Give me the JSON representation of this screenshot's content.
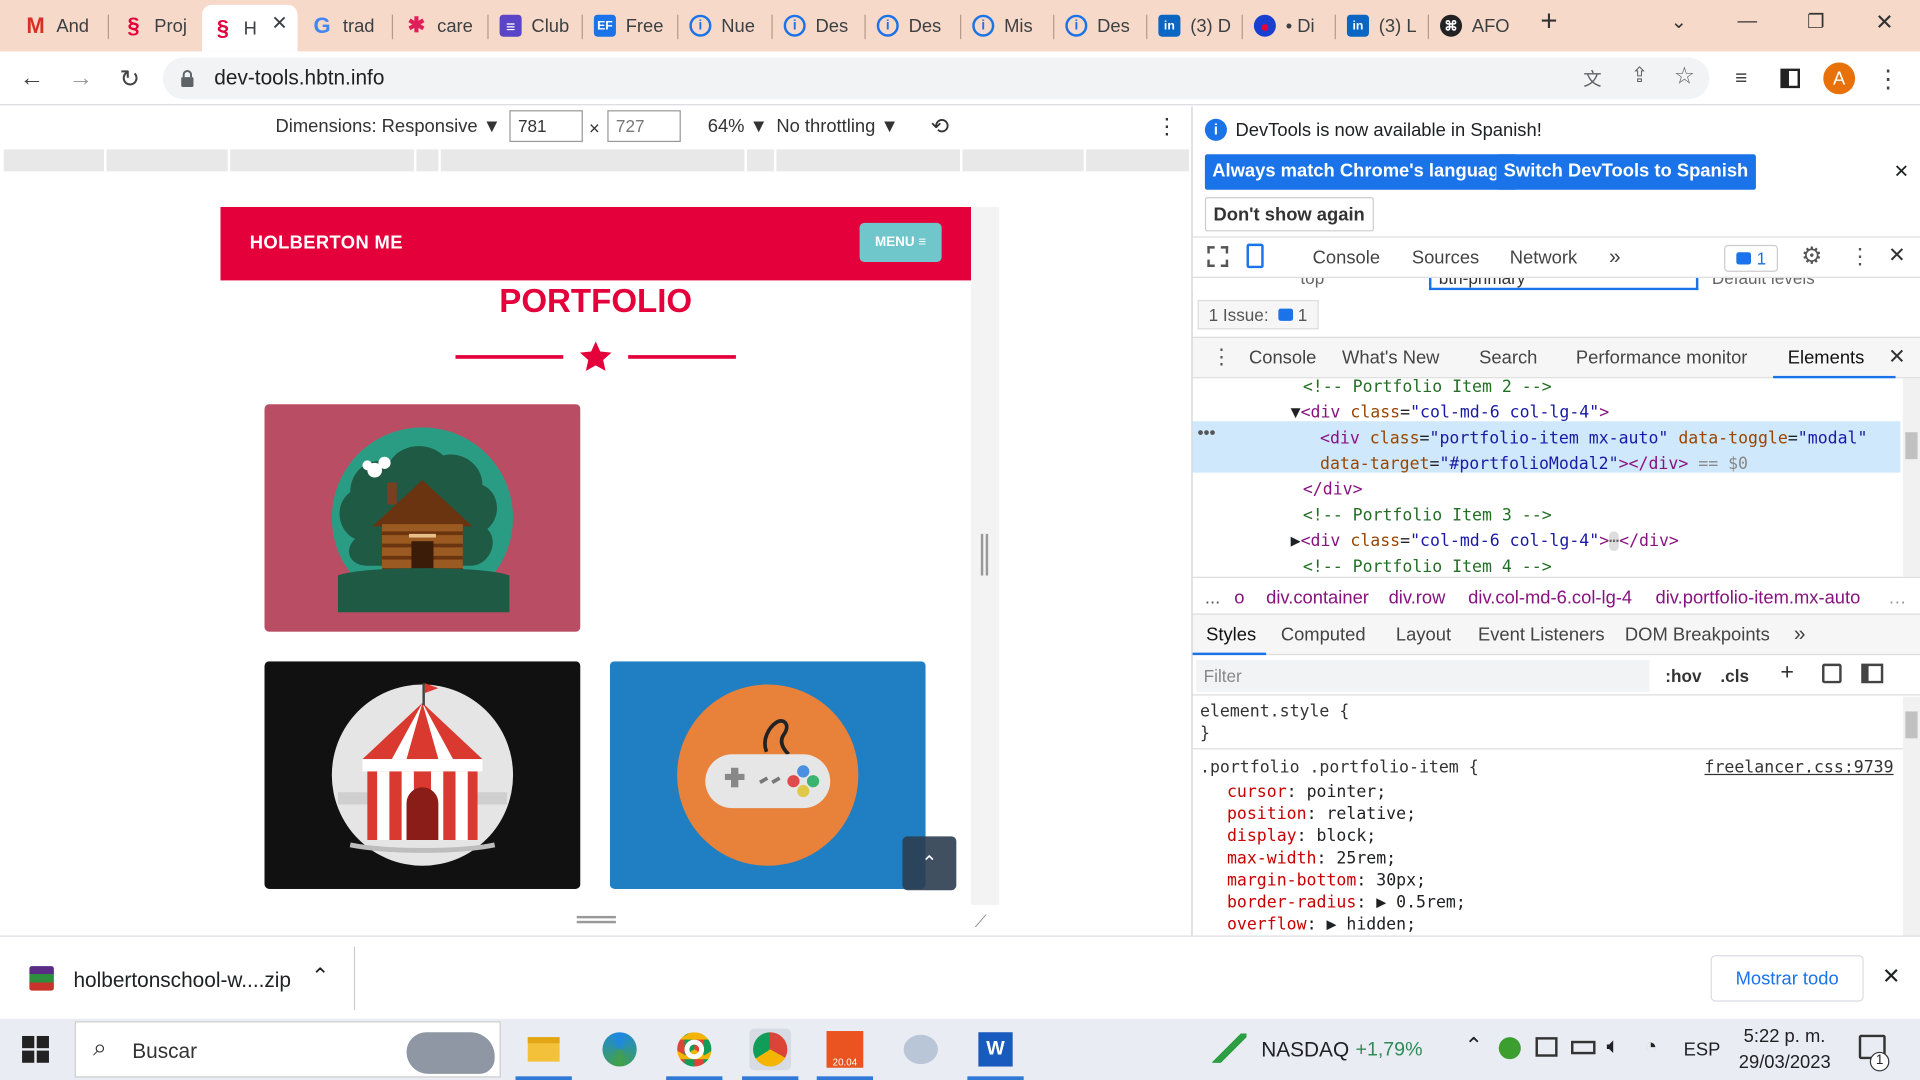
{
  "tabs": [
    {
      "label": "And",
      "icon": "gmail-icon"
    },
    {
      "label": "Proj",
      "icon": "holberton-icon"
    },
    {
      "label": "H",
      "icon": "holberton-icon"
    },
    {
      "label": "trad",
      "icon": "google-icon"
    },
    {
      "label": "care",
      "icon": "slack-icon"
    },
    {
      "label": "Club",
      "icon": "club-icon"
    },
    {
      "label": "Free",
      "icon": "ef-icon"
    },
    {
      "label": "Nue",
      "icon": "info-icon"
    },
    {
      "label": "Des",
      "icon": "info-icon"
    },
    {
      "label": "Des",
      "icon": "info-icon"
    },
    {
      "label": "Mis",
      "icon": "info-icon"
    },
    {
      "label": "Des",
      "icon": "info-icon"
    },
    {
      "label": "(3) D",
      "icon": "linkedin-icon"
    },
    {
      "label": "• Di",
      "icon": "app-icon"
    },
    {
      "label": "(3) L",
      "icon": "linkedin-icon"
    },
    {
      "label": "AFO",
      "icon": "github-icon"
    }
  ],
  "address": {
    "url": "dev-tools.hbtn.info"
  },
  "profile_initial": "A",
  "device_toolbar": {
    "dimensions_label": "Dimensions: Responsive",
    "width": "781",
    "height": "727",
    "times": "×",
    "zoom": "64%",
    "throttling": "No throttling"
  },
  "site": {
    "brand": "HOLBERTON ME",
    "menu_label": "MENU ≡",
    "section_title": "PORTFOLIO",
    "cards": [
      {
        "name": "cabin",
        "bg": "#b94d63"
      },
      {
        "name": "circus",
        "bg": "#111111"
      },
      {
        "name": "game",
        "bg": "#1f7fc2"
      }
    ]
  },
  "devtools": {
    "banner_text": "DevTools is now available in Spanish!",
    "banner_btn1": "Always match Chrome's language",
    "banner_btn2": "Switch DevTools to Spanish",
    "banner_btn3": "Don't show again",
    "top_tabs": [
      "Console",
      "Sources",
      "Network",
      "»"
    ],
    "issues_badge": "1",
    "issues_label": "1 Issue:",
    "issues_count": "1",
    "filter_value": "btn-primary",
    "context": "top",
    "levels": "Default levels",
    "drawer_tabs": [
      "Console",
      "What's New",
      "Search",
      "Performance monitor",
      "Elements"
    ],
    "dom_lines": [
      {
        "indent": 90,
        "html": "<span class='cmt'>&lt;!-- Portfolio Item 2 --&gt;</span>"
      },
      {
        "indent": 80,
        "html": "▼<span class='tag'>&lt;div</span> <span class='attr'>class</span>=<span class='val'>\"col-md-6 col-lg-4\"</span><span class='tag'>&gt;</span>"
      },
      {
        "indent": 104,
        "html": "<span class='tag'>&lt;div</span> <span class='attr'>class</span>=<span class='val'>\"portfolio-item mx-auto\"</span> <span class='attr'>data-toggle</span>=<span class='val'>\"modal\"</span>"
      },
      {
        "indent": 104,
        "html": "<span class='attr'>data-target</span>=<span class='val'>\"#portfolioModal2\"</span><span class='tag'>&gt;&lt;/div&gt;</span> <span style='color:#888'>== $0</span>"
      },
      {
        "indent": 90,
        "html": "<span class='tag'>&lt;/div&gt;</span>"
      },
      {
        "indent": 90,
        "html": "<span class='cmt'>&lt;!-- Portfolio Item 3 --&gt;</span>"
      },
      {
        "indent": 80,
        "html": "▶<span class='tag'>&lt;div</span> <span class='attr'>class</span>=<span class='val'>\"col-md-6 col-lg-4\"</span><span class='tag'>&gt;</span><span style='background:#ddd;border-radius:6px;color:#666'>⋯</span><span class='tag'>&lt;/div&gt;</span>"
      },
      {
        "indent": 90,
        "html": "<span class='cmt'>&lt;!-- Portfolio Item 4 --&gt;</span>"
      }
    ],
    "breadcrumbs": [
      "...",
      "o",
      "div.container",
      "div.row",
      "div.col-md-6.col-lg-4",
      "div.portfolio-item.mx-auto"
    ],
    "style_tabs": [
      "Styles",
      "Computed",
      "Layout",
      "Event Listeners",
      "DOM Breakpoints",
      "»"
    ],
    "filter_placeholder": "Filter",
    "hov": ":hov",
    "cls": ".cls",
    "element_style_open": "element.style {",
    "element_style_close": "}",
    "rule_selector": ".portfolio .portfolio-item {",
    "rule_source": "freelancer.css:9739",
    "declarations": [
      {
        "prop": "cursor",
        "value": "pointer;"
      },
      {
        "prop": "position",
        "value": "relative;"
      },
      {
        "prop": "display",
        "value": "block;"
      },
      {
        "prop": "max-width",
        "value": "25rem;"
      },
      {
        "prop": "margin-bottom",
        "value": "30px;"
      },
      {
        "prop": "border-radius",
        "value": "▶ 0.5rem;"
      },
      {
        "prop": "overflow",
        "value": "▶ hidden;"
      }
    ]
  },
  "download": {
    "filename": "holbertonschool-w....zip",
    "show_all": "Mostrar todo"
  },
  "taskbar": {
    "search": "Buscar",
    "ticker": "NASDAQ",
    "change": "+1,79%",
    "lang": "ESP",
    "time": "5:22 p. m.",
    "date": "29/03/2023",
    "notifications": "1",
    "ubuntu": "20.04"
  }
}
